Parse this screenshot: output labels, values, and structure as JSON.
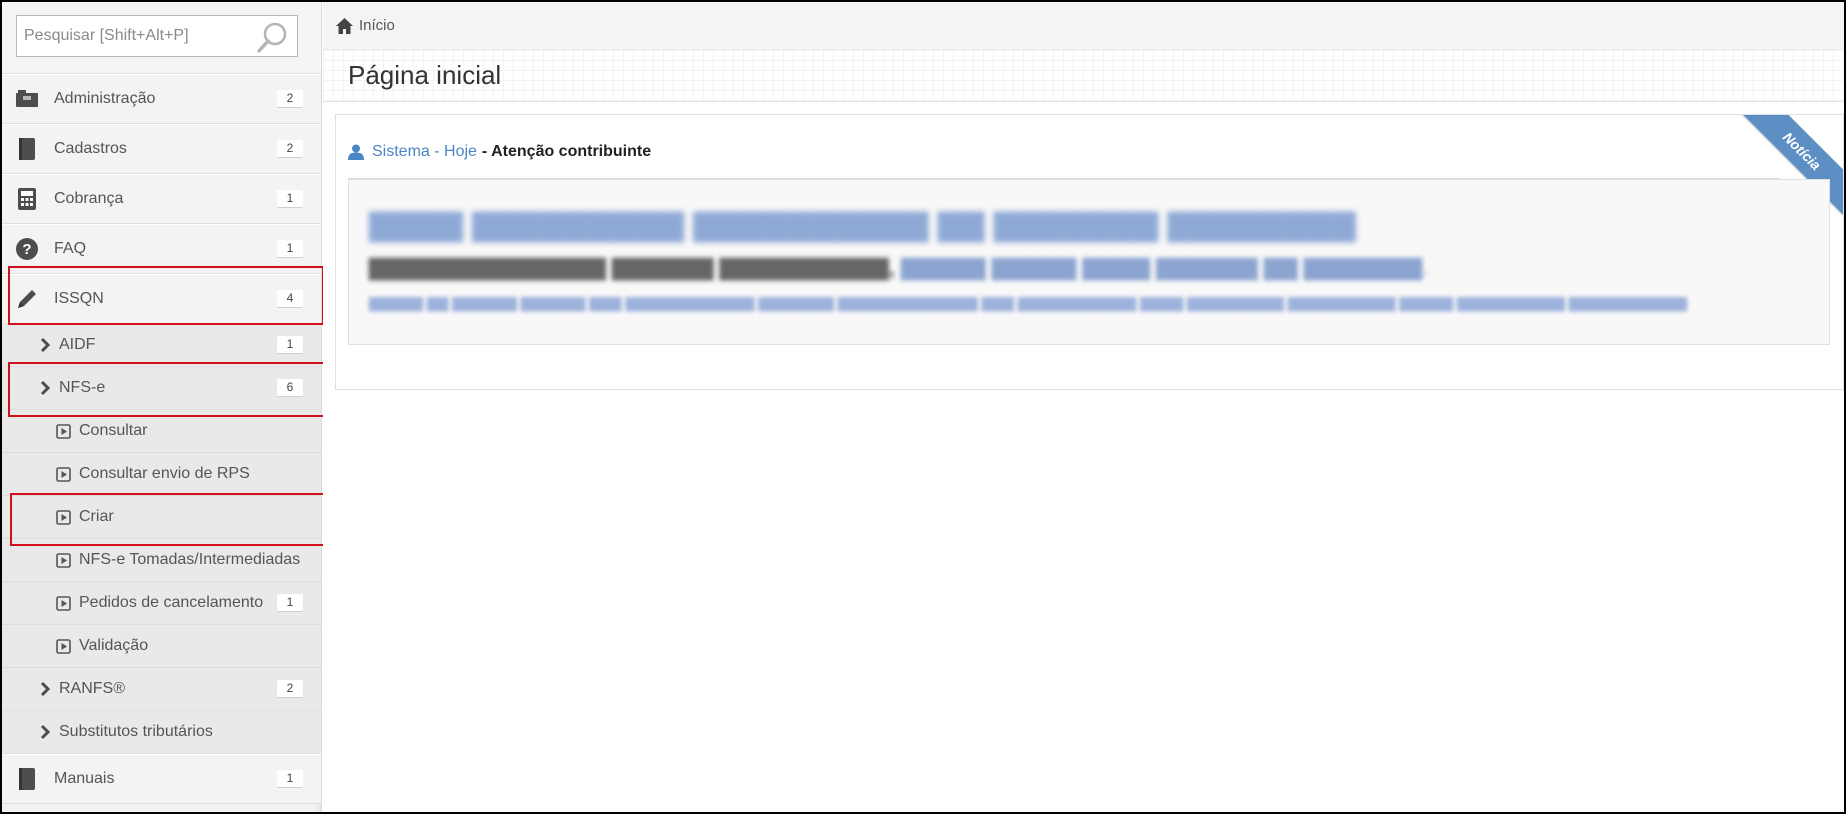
{
  "search": {
    "placeholder": "Pesquisar [Shift+Alt+P]"
  },
  "sidebar": {
    "items": [
      {
        "label": "Administração",
        "badge": "2",
        "icon": "folder-icon"
      },
      {
        "label": "Cadastros",
        "badge": "2",
        "icon": "book-icon"
      },
      {
        "label": "Cobrança",
        "badge": "1",
        "icon": "calculator-icon"
      },
      {
        "label": "FAQ",
        "badge": "1",
        "icon": "question-icon"
      },
      {
        "label": "ISSQN",
        "badge": "4",
        "icon": "pencil-icon"
      }
    ],
    "issqn_children": {
      "aidf": {
        "label": "AIDF",
        "badge": "1"
      },
      "nfse": {
        "label": "NFS-e",
        "badge": "6"
      },
      "nfse_children": [
        {
          "label": "Consultar"
        },
        {
          "label": "Consultar envio de RPS"
        },
        {
          "label": "Criar"
        },
        {
          "label": "NFS-e Tomadas/Intermediadas"
        },
        {
          "label": "Pedidos de cancelamento",
          "badge": "1"
        },
        {
          "label": "Validação"
        }
      ],
      "ranfs": {
        "label": "RANFS®",
        "badge": "2"
      },
      "substitutos": {
        "label": "Substitutos tributários"
      }
    },
    "manuais": {
      "label": "Manuais",
      "badge": "1"
    }
  },
  "breadcrumb": {
    "home_label": "Início"
  },
  "page": {
    "title": "Página inicial"
  },
  "news": {
    "source": "Sistema - Hoje",
    "separator": " - ",
    "title": "Atenção contribuinte",
    "ribbon": "Notícia"
  },
  "colors": {
    "accent": "#4a86c5",
    "highlight": "#d0101a",
    "ribbon": "#5d8fc4"
  }
}
